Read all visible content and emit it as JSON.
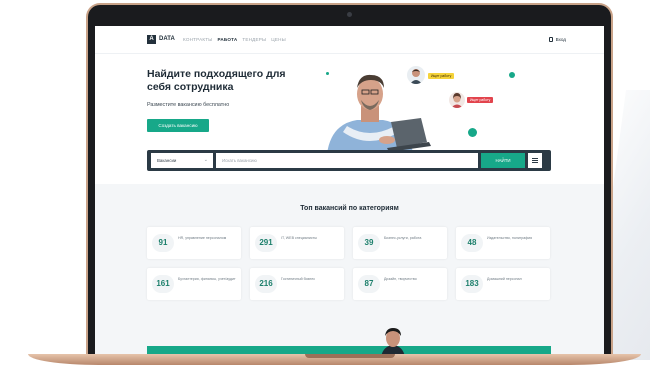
{
  "nav": {
    "logo_letter": "A",
    "brand": "DATA",
    "links": [
      "КОНТРАКТЫ",
      "РАБОТА",
      "ТЕНДЕРЫ",
      "ЦЕНЫ"
    ],
    "active_link": "РАБОТА",
    "login": "Вход"
  },
  "hero": {
    "title": "Найдите подходящего для себя сотрудника",
    "subtitle": "Разместите вакансию бесплатно",
    "cta": "Создать вакансию",
    "chip_yellow": "Ищет работу",
    "chip_red": "Ищет работу"
  },
  "search": {
    "select_value": "Вакансии",
    "placeholder": "Искать вакансию",
    "button": "НАЙТИ"
  },
  "categories": {
    "title": "Топ вакансий по категориям",
    "items": [
      {
        "count": "91",
        "label": "HR, управление персоналом"
      },
      {
        "count": "291",
        "label": "IT, WEB специалисты"
      },
      {
        "count": "39",
        "label": "Бизнес-услуги, работа"
      },
      {
        "count": "48",
        "label": "Издательство, полиграфия"
      },
      {
        "count": "161",
        "label": "Бухгалтерия, финансы, учет/аудит"
      },
      {
        "count": "216",
        "label": "Гостиничный бизнес"
      },
      {
        "count": "87",
        "label": "Дизайн, творчество"
      },
      {
        "count": "183",
        "label": "Домашний персонал"
      }
    ]
  },
  "colors": {
    "accent": "#17a889",
    "dark": "#2b3a45",
    "frame": "#c9a389"
  }
}
